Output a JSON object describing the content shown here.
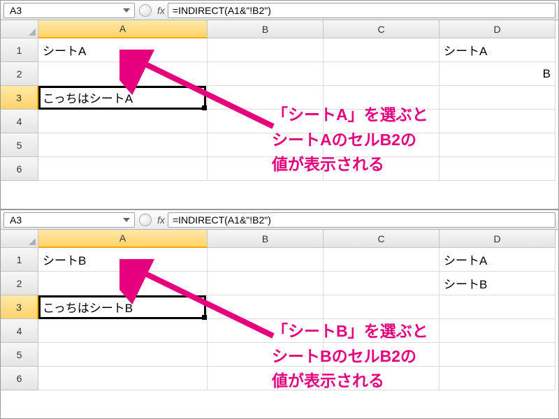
{
  "top": {
    "nameBox": "A3",
    "formula": "=INDIRECT(A1&\"!B2\")",
    "columns": [
      "A",
      "B",
      "C",
      "D"
    ],
    "rows": [
      "1",
      "2",
      "3",
      "4",
      "5",
      "6"
    ],
    "cells": {
      "A1": "シートA",
      "A3": "こっちはシートA",
      "D1": "シートA",
      "D2_partial": "B"
    },
    "annotation": "「シートA」を選ぶと\nシートAのセルB2の\n値が表示される"
  },
  "bottom": {
    "nameBox": "A3",
    "formula": "=INDIRECT(A1&\"!B2\")",
    "columns": [
      "A",
      "B",
      "C",
      "D"
    ],
    "rows": [
      "1",
      "2",
      "3",
      "4",
      "5",
      "6"
    ],
    "cells": {
      "A1": "シートB",
      "A3": "こっちはシートB",
      "D1": "シートA",
      "D2": "シートB"
    },
    "annotation": "「シートB」を選ぶと\nシートBのセルB2の\n値が表示される"
  },
  "fxLabel": "fx"
}
